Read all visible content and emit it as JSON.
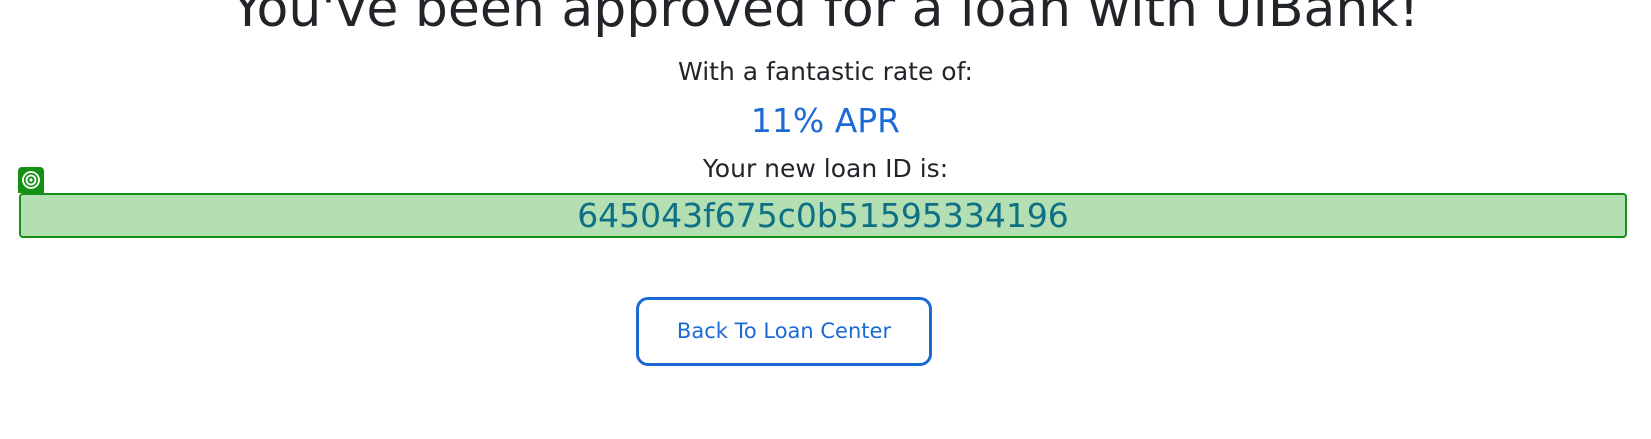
{
  "headline": "You've been approved for a loan with UIBank!",
  "rate": {
    "label": "With a fantastic rate of:",
    "value": "11% APR"
  },
  "loan_id": {
    "label": "Your new loan ID is:",
    "value": "645043f675c0b51595334196"
  },
  "highlight": {
    "icon": "target-icon",
    "fill_color": "#b3dfb3",
    "border_color": "#159015"
  },
  "actions": {
    "back_label": "Back To Loan Center"
  },
  "colors": {
    "accent": "#1b6ad6",
    "loan_id_text": "#0f6f84",
    "text": "#212529"
  }
}
